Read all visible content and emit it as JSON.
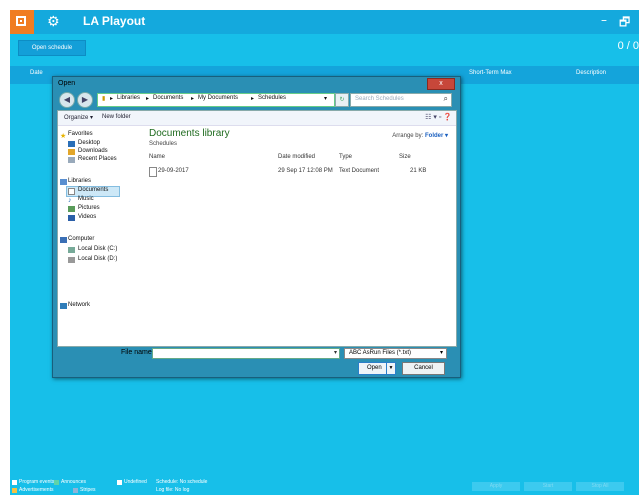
{
  "app": {
    "title": "LA Playout",
    "minimize": "–",
    "restore": "🗗",
    "open_schedule": "Open schedule",
    "counter": "0 / 0"
  },
  "columns": [
    "Date",
    "",
    "",
    "",
    "",
    "",
    "",
    "",
    "Short-Term Max",
    "Description"
  ],
  "legend": {
    "program_events": "Program events",
    "announces": "Announces",
    "undefined": "Undefined",
    "advertisements": "Advertisements",
    "stripes": "Stripes",
    "schedule": "Schedule: No schedule",
    "logfile": "Log file: No log"
  },
  "bottom_buttons": [
    "Apply",
    "Start",
    "Stop All"
  ],
  "dialog": {
    "title": "Open",
    "close": "x",
    "breadcrumb": [
      "Libraries",
      "Documents",
      "My Documents",
      "Schedules"
    ],
    "search_placeholder": "Search Schedules",
    "organize": "Organize ▾",
    "new_folder": "New folder",
    "nav": {
      "favorites": "Favorites",
      "desktop": "Desktop",
      "downloads": "Downloads",
      "recent_places": "Recent Places",
      "libraries": "Libraries",
      "documents": "Documents",
      "music": "Music",
      "pictures": "Pictures",
      "videos": "Videos",
      "computer": "Computer",
      "local_c": "Local Disk (C:)",
      "local_d": "Local Disk (D:)",
      "network": "Network"
    },
    "library_title": "Documents library",
    "library_sub": "Schedules",
    "arrange_label": "Arrange by:",
    "arrange_value": "Folder ▾",
    "headers": {
      "name": "Name",
      "date_modified": "Date modified",
      "type": "Type",
      "size": "Size"
    },
    "files": [
      {
        "name": "29-09-2017",
        "date": "29 Sep 17 12:08 PM",
        "type": "Text Document",
        "size": "21 KB"
      }
    ],
    "file_name_label": "File name:",
    "file_type": "ABC AsRun Files (*.txt)",
    "open": "Open",
    "cancel": "Cancel"
  },
  "colors": {
    "app_bg": "#17bfe9",
    "logo": "#f07d22",
    "dialog_frame": "#2a8fb4"
  }
}
